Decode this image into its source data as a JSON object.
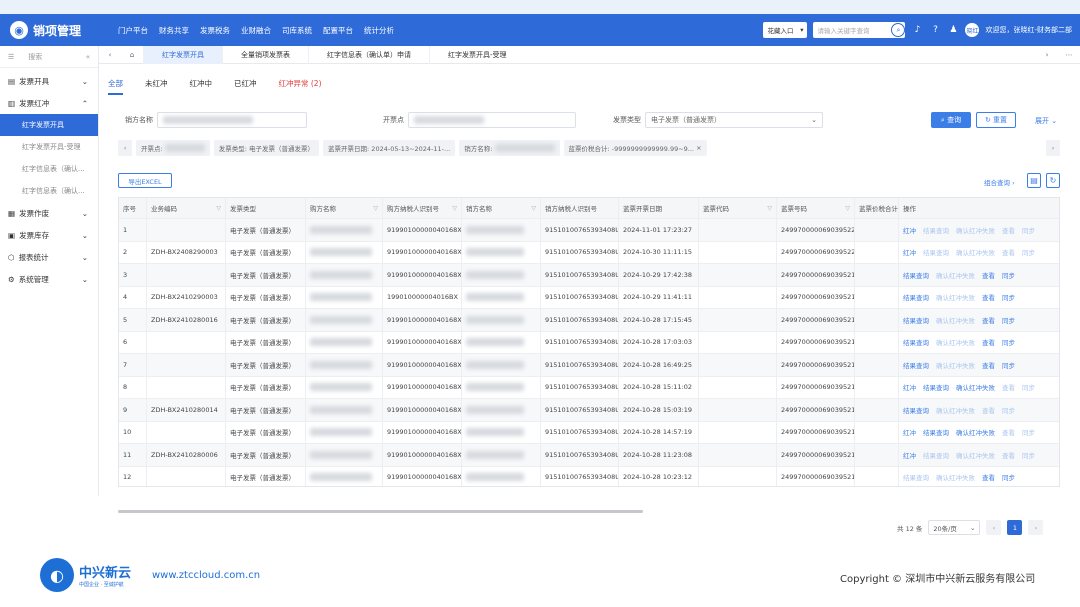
{
  "header": {
    "logo_text": "销项管理",
    "logo_icon": "logo-circle",
    "nav": [
      "门户平台",
      "财务共享",
      "发票税务",
      "业财融合",
      "司库系统",
      "配置平台",
      "统计分析"
    ],
    "entry_select": "花藏入口",
    "search_placeholder": "请输入关键字查询",
    "user_text": "欢迎您，张晓红-财务部二部",
    "avatar_text": "晓红"
  },
  "sidebar": {
    "search_placeholder": "搜索",
    "items": [
      {
        "label": "发票开具",
        "icon": "invoice-icon",
        "expanded": false
      },
      {
        "label": "发票红冲",
        "icon": "red-invoice-icon",
        "expanded": true,
        "children": [
          "红字发票开具",
          "红字发票开具-受理",
          "红字信息表（确认...",
          "红字信息表（确认..."
        ]
      },
      {
        "label": "发票作废",
        "icon": "void-icon",
        "expanded": false
      },
      {
        "label": "发票库存",
        "icon": "stock-icon",
        "expanded": false
      },
      {
        "label": "报表统计",
        "icon": "report-icon",
        "expanded": false
      },
      {
        "label": "系统管理",
        "icon": "settings-icon",
        "expanded": false
      }
    ]
  },
  "tabs": [
    "红字发票开具",
    "全量销项发票表",
    "红字信息表（确认单）申请",
    "红字发票开具-受理"
  ],
  "subtabs": [
    "全部",
    "未红冲",
    "红冲中",
    "已红冲",
    "红冲异常 (2)"
  ],
  "filters": {
    "seller_label": "销方名称",
    "issuer_label": "开票点",
    "invoice_type_label": "发票类型",
    "invoice_type_value": "电子发票（普通发票）",
    "query_button": "查询",
    "reset_button": "重置",
    "expand_button": "展开"
  },
  "chips": [
    "开票点:",
    "发票类型: 电子发票（普通发票）",
    "蓝票开票日期: 2024-05-13~2024-11-...",
    "销方名称:",
    "蓝票价税合计: -9999999999999.99~9..."
  ],
  "toolbar": {
    "export_button": "导出EXCEL",
    "combo_query": "组合查询"
  },
  "table": {
    "columns": [
      "序号",
      "业务编码",
      "发票类型",
      "购方名称",
      "购方纳税人识别号",
      "销方名称",
      "销方纳税人识别号",
      "蓝票开票日期",
      "蓝票代码",
      "蓝票号码",
      "蓝票价税合计",
      "操作"
    ],
    "rows": [
      {
        "no": "1",
        "code": "",
        "type": "电子发票（普通发票）",
        "tax": "91990100000040168X",
        "seller_tax": "91510100765393408U",
        "date": "2024-11-01 17:23:27",
        "blue_no": "249970000069039522...",
        "actions": [
          "红冲",
          "结果查询",
          "确认红冲失败",
          "查看",
          "同步"
        ],
        "enabled": [
          true,
          false,
          false,
          false,
          false
        ]
      },
      {
        "no": "2",
        "code": "ZDH-BX2408290003",
        "type": "电子发票（普通发票）",
        "tax": "91990100000040168X",
        "seller_tax": "91510100765393408U",
        "date": "2024-10-30 11:11:15",
        "blue_no": "249970000069039522...",
        "actions": [
          "红冲",
          "结果查询",
          "确认红冲失败",
          "查看",
          "同步"
        ],
        "enabled": [
          true,
          false,
          false,
          false,
          false
        ]
      },
      {
        "no": "3",
        "code": "",
        "type": "电子发票（普通发票）",
        "tax": "91990100000040168X",
        "seller_tax": "91510100765393408U",
        "date": "2024-10-29 17:42:38",
        "blue_no": "249970000069039521...",
        "actions": [
          "结果查询",
          "确认红冲失败",
          "查看",
          "同步"
        ],
        "enabled": [
          true,
          false,
          true,
          true
        ]
      },
      {
        "no": "4",
        "code": "ZDH-BX2410290003",
        "type": "电子发票（普通发票）",
        "tax": "199010000004016BX",
        "seller_tax": "91510100765393408U",
        "date": "2024-10-29 11:41:11",
        "blue_no": "249970000069039521...",
        "actions": [
          "结果查询",
          "确认红冲失败",
          "查看",
          "同步"
        ],
        "enabled": [
          true,
          false,
          true,
          true
        ]
      },
      {
        "no": "5",
        "code": "ZDH-BX2410280016",
        "type": "电子发票（普通发票）",
        "tax": "91990100000040168X",
        "seller_tax": "91510100765393408U",
        "date": "2024-10-28 17:15:45",
        "blue_no": "249970000069039521...",
        "actions": [
          "结果查询",
          "确认红冲失败",
          "查看",
          "同步"
        ],
        "enabled": [
          true,
          false,
          true,
          true
        ]
      },
      {
        "no": "6",
        "code": "",
        "type": "电子发票（普通发票）",
        "tax": "91990100000040168X",
        "seller_tax": "91510100765393408U",
        "date": "2024-10-28 17:03:03",
        "blue_no": "249970000069039521...",
        "actions": [
          "结果查询",
          "确认红冲失败",
          "查看",
          "同步"
        ],
        "enabled": [
          true,
          false,
          true,
          true
        ]
      },
      {
        "no": "7",
        "code": "",
        "type": "电子发票（普通发票）",
        "tax": "91990100000040168X",
        "seller_tax": "91510100765393408U",
        "date": "2024-10-28 16:49:25",
        "blue_no": "249970000069039521...",
        "actions": [
          "结果查询",
          "确认红冲失败",
          "查看",
          "同步"
        ],
        "enabled": [
          true,
          false,
          true,
          true
        ]
      },
      {
        "no": "8",
        "code": "",
        "type": "电子发票（普通发票）",
        "tax": "91990100000040168X",
        "seller_tax": "91510100765393408U",
        "date": "2024-10-28 15:11:02",
        "blue_no": "249970000069039521...",
        "actions": [
          "红冲",
          "结果查询",
          "确认红冲失败",
          "查看",
          "同步"
        ],
        "enabled": [
          true,
          true,
          true,
          false,
          false
        ]
      },
      {
        "no": "9",
        "code": "ZDH-BX2410280014",
        "type": "电子发票（普通发票）",
        "tax": "91990100000040168X",
        "seller_tax": "91510100765393408U",
        "date": "2024-10-28 15:03:19",
        "blue_no": "249970000069039521...",
        "actions": [
          "结果查询",
          "确认红冲失败",
          "查看",
          "同步"
        ],
        "enabled": [
          true,
          false,
          false,
          false
        ]
      },
      {
        "no": "10",
        "code": "",
        "type": "电子发票（普通发票）",
        "tax": "91990100000040168X",
        "seller_tax": "91510100765393408U",
        "date": "2024-10-28 14:57:19",
        "blue_no": "249970000069039521...",
        "actions": [
          "红冲",
          "结果查询",
          "确认红冲失败",
          "查看",
          "同步"
        ],
        "enabled": [
          true,
          true,
          true,
          false,
          false
        ]
      },
      {
        "no": "11",
        "code": "ZDH-BX2410280006",
        "type": "电子发票（普通发票）",
        "tax": "91990100000040168X",
        "seller_tax": "91510100765393408U",
        "date": "2024-10-28 11:23:08",
        "blue_no": "249970000069039521...",
        "actions": [
          "红冲",
          "结果查询",
          "确认红冲失败",
          "查看",
          "同步"
        ],
        "enabled": [
          true,
          false,
          false,
          false,
          false
        ]
      },
      {
        "no": "12",
        "code": "",
        "type": "电子发票（普通发票）",
        "tax": "91990100000040168X",
        "seller_tax": "91510100765393408U",
        "date": "2024-10-28 10:23:12",
        "blue_no": "249970000069039521...",
        "actions": [
          "结果查询",
          "确认红冲失败",
          "查看",
          "同步"
        ],
        "enabled": [
          false,
          false,
          true,
          true
        ]
      }
    ]
  },
  "pagination": {
    "total": "共 12 条",
    "page_size": "20条/页",
    "current": "1"
  },
  "footer": {
    "brand": "中兴新云",
    "slogan": "中国企业 · 至诚护航",
    "url": "www.ztccloud.com.cn",
    "copyright": "Copyright © 深圳市中兴新云服务有限公司"
  },
  "colors": {
    "primary": "#2f6bd8",
    "danger": "#e23b3b"
  }
}
